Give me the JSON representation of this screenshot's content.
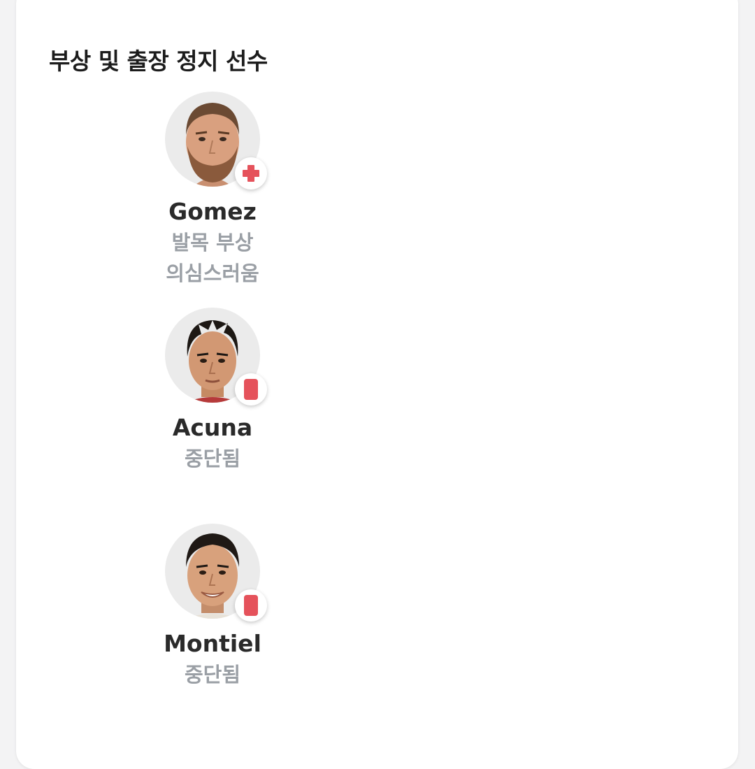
{
  "section": {
    "title": "부상 및 출장 정지 선수"
  },
  "colors": {
    "injury_red": "#e5525b",
    "card_red": "#e5525b",
    "name_text": "#2a2a2a",
    "status_text": "#9a9fa5"
  },
  "players": [
    {
      "name": "Gomez",
      "status_icon": "injury-cross-icon",
      "status_lines": [
        "발목 부상",
        "의심스러움"
      ]
    },
    {
      "name": "Acuna",
      "status_icon": "red-card-icon",
      "status_lines": [
        "중단됨"
      ]
    },
    {
      "name": "Montiel",
      "status_icon": "red-card-icon",
      "status_lines": [
        "중단됨"
      ]
    }
  ]
}
